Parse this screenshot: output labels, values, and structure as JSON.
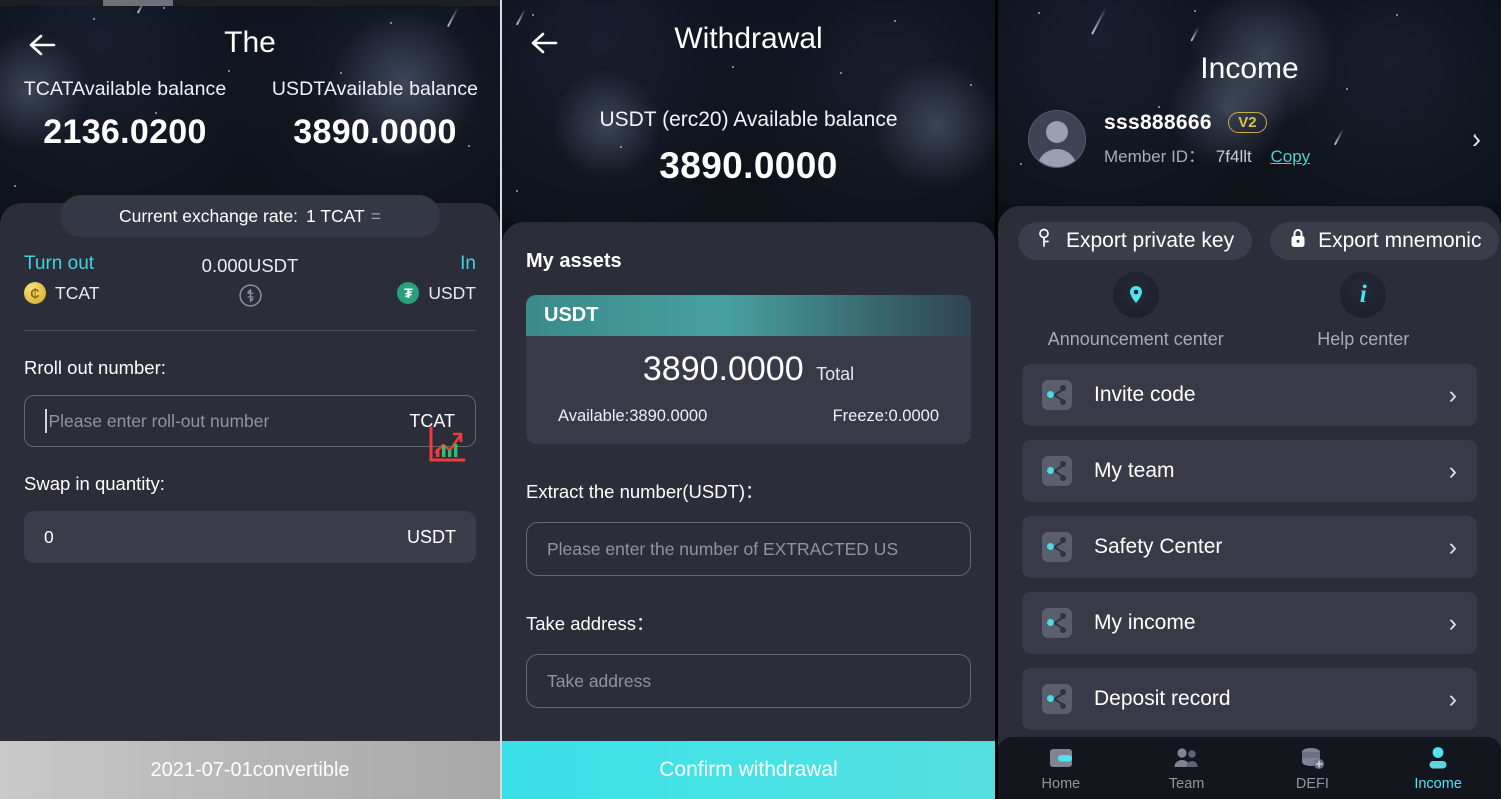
{
  "panel1": {
    "nav": {
      "title": "The",
      "back_icon": "back-arrow-icon"
    },
    "balances": [
      {
        "label": "TCATAvailable balance",
        "value": "2136.0200"
      },
      {
        "label": "USDTAvailable balance",
        "value": "3890.0000"
      }
    ],
    "rate_pill": {
      "text": "Current exchange rate:",
      "value": "1 TCAT",
      "equals": "="
    },
    "swap": {
      "out_caption": "Turn out",
      "out_coin": "TCAT",
      "mid_amount": "0.000USDT",
      "in_caption": "In",
      "in_coin": "USDT",
      "swap_icon": "swap-circle-icon"
    },
    "rollout": {
      "label": "Rroll out number:",
      "placeholder": "Please enter roll-out number",
      "value": "",
      "suffix": "TCAT"
    },
    "swapin": {
      "label": "Swap in quantity:",
      "value": "0",
      "suffix": "USDT"
    },
    "chart_icon": "candlestick-chart-icon",
    "footer": "2021-07-01convertible"
  },
  "panel2": {
    "nav": {
      "title": "Withdrawal",
      "back_icon": "back-arrow-icon"
    },
    "subtitle": "USDT (erc20) Available balance",
    "balance": "3890.0000",
    "section_title": "My assets",
    "asset_card": {
      "symbol": "USDT",
      "total_value": "3890.0000",
      "total_label": "Total",
      "available": "Available:3890.0000",
      "freeze": "Freeze:0.0000"
    },
    "extract": {
      "label": "Extract the number(USDT)：",
      "placeholder": "Please enter the number of EXTRACTED US",
      "value": ""
    },
    "address": {
      "label": "Take address：",
      "placeholder": "Take address",
      "value": ""
    },
    "cta": "Confirm withdrawal"
  },
  "panel3": {
    "title": "Income",
    "user": {
      "name": "sss888666",
      "level_badge": "V2",
      "member_id_label": "Member ID：",
      "member_id": "7f4llt",
      "copy": "Copy",
      "chevron": "›",
      "avatar_icon": "avatar-icon"
    },
    "export_buttons": [
      {
        "label": "Export private key",
        "icon": "key-icon"
      },
      {
        "label": "Export mnemonic",
        "icon": "lock-icon"
      }
    ],
    "centers": [
      {
        "label": "Announcement center",
        "icon": "location-pin-icon"
      },
      {
        "label": "Help center",
        "icon": "info-icon"
      }
    ],
    "menu_items": [
      {
        "label": "Invite code",
        "icon": "share-nodes-icon",
        "chevron": "›"
      },
      {
        "label": "My team",
        "icon": "share-nodes-icon",
        "chevron": "›"
      },
      {
        "label": "Safety Center",
        "icon": "share-nodes-icon",
        "chevron": "›"
      },
      {
        "label": "My income",
        "icon": "share-nodes-icon",
        "chevron": "›"
      },
      {
        "label": "Deposit record",
        "icon": "share-nodes-icon",
        "chevron": "›"
      }
    ],
    "tabs": [
      {
        "label": "Home",
        "icon": "wallet-icon",
        "active": false
      },
      {
        "label": "Team",
        "icon": "people-icon",
        "active": false
      },
      {
        "label": "DEFI",
        "icon": "coins-plus-icon",
        "active": false
      },
      {
        "label": "Income",
        "icon": "person-icon",
        "active": true
      }
    ]
  },
  "colors": {
    "accent_cyan": "#4fe3ef",
    "panel_bg": "#2b2d39",
    "card_bg": "#383b47",
    "hero_bg": "#0b0e16",
    "gold": "#d9c04f",
    "teal_header": "#47a0a0",
    "chart_red": "#ef3b3b"
  }
}
